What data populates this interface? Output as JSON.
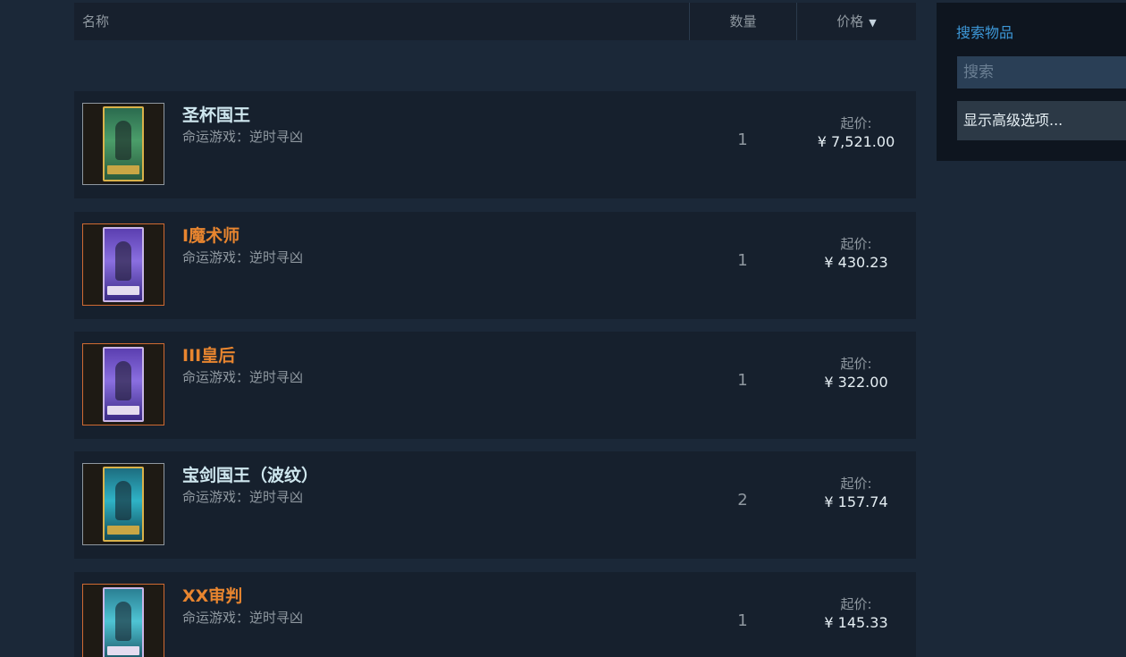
{
  "header": {
    "name_label": "名称",
    "qty_label": "数量",
    "price_label": "价格"
  },
  "rows": [
    {
      "name": "圣杯国王",
      "name_color": "#cfe7ef",
      "game": "命运游戏：逆时寻凶",
      "qty": "1",
      "price_label": "起价:",
      "price": "¥ 7,521.00",
      "thumb_border": "#8f98a0",
      "card": "green"
    },
    {
      "name": "I魔术师",
      "name_color": "#e8852f",
      "game": "命运游戏：逆时寻凶",
      "qty": "1",
      "price_label": "起价:",
      "price": "¥ 430.23",
      "thumb_border": "#cf6a32",
      "card": "purple"
    },
    {
      "name": "III皇后",
      "name_color": "#e8852f",
      "game": "命运游戏：逆时寻凶",
      "qty": "1",
      "price_label": "起价:",
      "price": "¥ 322.00",
      "thumb_border": "#cf6a32",
      "card": "purple"
    },
    {
      "name": "宝剑国王（波纹）",
      "name_color": "#cfe7ef",
      "game": "命运游戏：逆时寻凶",
      "qty": "2",
      "price_label": "起价:",
      "price": "¥ 157.74",
      "thumb_border": "#8f98a0",
      "card": "teal"
    },
    {
      "name": "XX审判",
      "name_color": "#e8852f",
      "game": "命运游戏：逆时寻凶",
      "qty": "1",
      "price_label": "起价:",
      "price": "¥ 145.33",
      "thumb_border": "#cf6a32",
      "card": "cyan"
    }
  ],
  "sidebar": {
    "title": "搜索物品",
    "search_placeholder": "搜索",
    "advanced_label": "显示高级选项..."
  },
  "icons": {
    "sort": "sort-desc-icon"
  }
}
